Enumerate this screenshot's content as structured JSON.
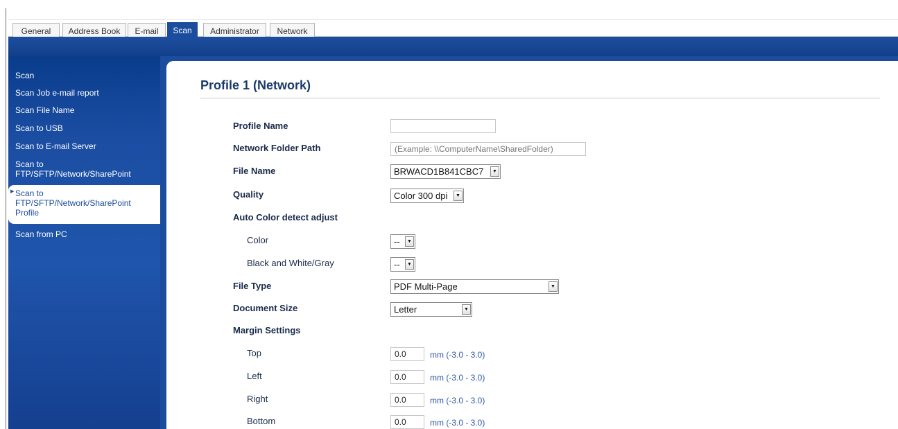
{
  "tabs": [
    {
      "label": "General"
    },
    {
      "label": "Address Book"
    },
    {
      "label": "E-mail"
    },
    {
      "label": "Scan"
    },
    {
      "label": "Administrator"
    },
    {
      "label": "Network"
    }
  ],
  "active_tab": "Scan",
  "sidebar": {
    "items": [
      {
        "label": "Scan"
      },
      {
        "label": "Scan Job e-mail report"
      },
      {
        "label": "Scan File Name"
      },
      {
        "label": "Scan to USB"
      },
      {
        "label": "Scan to E-mail Server"
      },
      {
        "label": "Scan to\nFTP/SFTP/Network/SharePoint"
      },
      {
        "label": "Scan to\nFTP/SFTP/Network/SharePoint\nProfile"
      },
      {
        "label": "Scan from PC"
      }
    ],
    "active_index": 6
  },
  "main": {
    "title": "Profile 1 (Network)",
    "profile_name": {
      "label": "Profile Name",
      "value": ""
    },
    "network_folder_path": {
      "label": "Network Folder Path",
      "placeholder": "(Example: \\\\ComputerName\\SharedFolder)"
    },
    "file_name": {
      "label": "File Name",
      "value": "BRWACD1B841CBC7"
    },
    "quality": {
      "label": "Quality",
      "value": "Color 300 dpi"
    },
    "auto_color": {
      "label": "Auto Color detect adjust",
      "color": {
        "label": "Color",
        "value": "--"
      },
      "bw_gray": {
        "label": "Black and White/Gray",
        "value": "--"
      }
    },
    "file_type": {
      "label": "File Type",
      "value": "PDF Multi-Page"
    },
    "document_size": {
      "label": "Document Size",
      "value": "Letter"
    },
    "margin": {
      "label": "Margin Settings",
      "unit_range": "mm (-3.0 - 3.0)",
      "top": {
        "label": "Top",
        "value": "0.0"
      },
      "left": {
        "label": "Left",
        "value": "0.0"
      },
      "right": {
        "label": "Right",
        "value": "0.0"
      },
      "bottom": {
        "label": "Bottom",
        "value": "0.0"
      }
    }
  },
  "colors": {
    "accent": "#1b4c9e",
    "sidebar_text": "#ffffff",
    "unit_text": "#2e57a8"
  }
}
